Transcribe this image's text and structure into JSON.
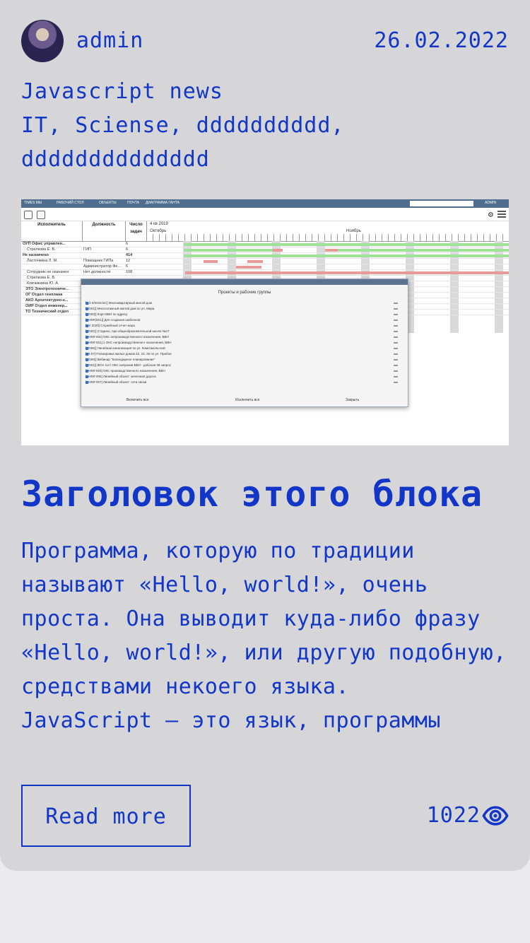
{
  "post": {
    "author": "admin",
    "date": "26.02.2022",
    "tags": [
      "Javascript news",
      "IT, Sciense, dddddddddd,",
      "dddddddddddddd"
    ],
    "title": "Заголовок этого блока",
    "body": [
      "Программа, которую по традиции называют «Hello, world!», очень проста. Она выводит куда-либо фразу «Hello, world!», или другую подобную, средствами некоего языка.",
      "JavaScript — это язык, программы"
    ],
    "read_more": "Read more",
    "views": "1022",
    "views_icon": "eye-icon",
    "accent_color": "#1236c8"
  },
  "screenshot": {
    "topbar": [
      "TIMES МЫ",
      "РАБОЧИЙ СТОЛ",
      "ОБЪЕКТЫ",
      "ПОЧТА",
      "ДИАГРАММА ГАНТА"
    ],
    "user": "ADMIN",
    "columns": [
      "Исполнитель",
      "Должность",
      "Число задач"
    ],
    "period": "4 кв 2019",
    "months": [
      "Октябрь",
      "Ноябрь"
    ],
    "rows": [
      {
        "name": "ОУП Офис управлен...",
        "role": "",
        "count": "6"
      },
      {
        "name": "Стрелкова Е. В.",
        "role": "ГИП",
        "count": "6"
      },
      {
        "name": "Не назначено",
        "role": "",
        "count": "414"
      },
      {
        "name": "Ласточкина Л. М.",
        "role": "Помощник ГИПа",
        "count": "12"
      },
      {
        "name": "",
        "role": "Администратор Фе...",
        "count": "6"
      },
      {
        "name": "Сотрудник не назначен",
        "role": "Нет должности",
        "count": "108"
      },
      {
        "name": "Стрелкова Е. В.",
        "role": "",
        "count": ""
      },
      {
        "name": "Ковчежкина Ю. А.",
        "role": "",
        "count": ""
      },
      {
        "name": "ЭТО Электротехниче...",
        "role": "",
        "count": ""
      },
      {
        "name": "ОГ Отдел генплана",
        "role": "",
        "count": ""
      },
      {
        "name": "АКО Архитектурно-к...",
        "role": "",
        "count": ""
      },
      {
        "name": "ОИР Отдел инженер...",
        "role": "",
        "count": ""
      },
      {
        "name": "ТО Технический отдел",
        "role": "",
        "count": ""
      }
    ],
    "dialog": {
      "title": "Проекты и рабочие группы",
      "items": [
        "[ДО 6/2018 БС] Многоквартирный жилой дом",
        "[(2001)] Многоэтажный жилой дом по ул. Мира",
        "[(2003)] Корп ВВН по адресу",
        "[ТНФЛ(001)] Для создания шаблонов",
        "[ОУ 2020] Служебный отчет мэра",
        "[(2002)] Стадион, при общеобразовательной школе №17",
        "[ТНФЛ-002] ОКС непроизводственного назначения, ВВН",
        "[ТНФЛ-001] 1 ОКС непроизводственного назначения, ВВН",
        "[(2006)] Линейная канализация по ул. Комсомольской",
        "[10-07] Планировка жилых домов 22, 24, 26 по ул. Прибоя",
        "[(2009)] Вебинар \"Календарное планирование\"",
        "[(2001)] ВСН тест ОКС непроизв ВВН - рабочая 39 запрос",
        "[ТНФЛ-003] ОКС производственного назначения, ВВН",
        "[ТНФЛ-006] Линейный объект: железная дорога",
        "[ТНФЛ-007] Линейный объект: сети связи"
      ],
      "buttons": [
        "Включить все",
        "Исключить все",
        "Закрыть"
      ]
    }
  }
}
